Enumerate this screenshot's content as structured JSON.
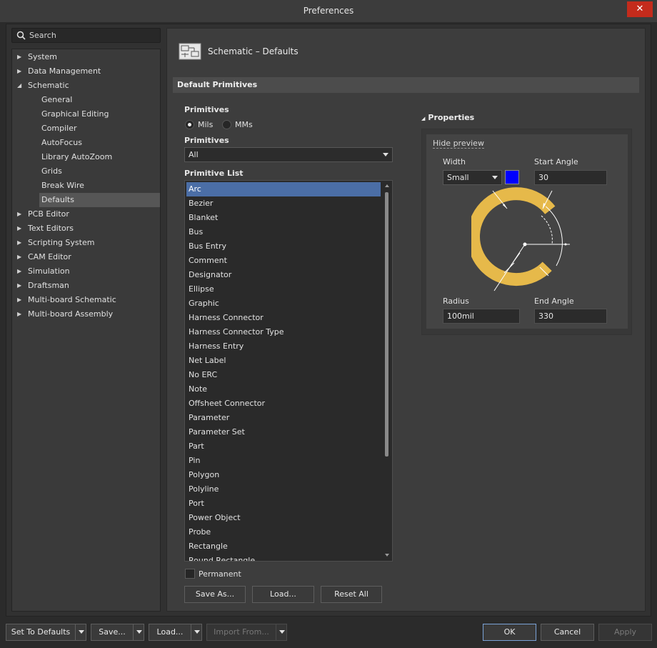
{
  "window": {
    "title": "Preferences",
    "close_symbol": "✕"
  },
  "search": {
    "placeholder": "Search"
  },
  "tree": {
    "items": [
      {
        "label": "System",
        "arrow": "▶",
        "level": 0
      },
      {
        "label": "Data Management",
        "arrow": "▶",
        "level": 0
      },
      {
        "label": "Schematic",
        "arrow": "◢",
        "level": 0
      },
      {
        "label": "General",
        "level": 1
      },
      {
        "label": "Graphical Editing",
        "level": 1
      },
      {
        "label": "Compiler",
        "level": 1
      },
      {
        "label": "AutoFocus",
        "level": 1
      },
      {
        "label": "Library AutoZoom",
        "level": 1
      },
      {
        "label": "Grids",
        "level": 1
      },
      {
        "label": "Break Wire",
        "level": 1
      },
      {
        "label": "Defaults",
        "level": 1,
        "selected": true
      },
      {
        "label": "PCB Editor",
        "arrow": "▶",
        "level": 0
      },
      {
        "label": "Text Editors",
        "arrow": "▶",
        "level": 0
      },
      {
        "label": "Scripting System",
        "arrow": "▶",
        "level": 0
      },
      {
        "label": "CAM Editor",
        "arrow": "▶",
        "level": 0
      },
      {
        "label": "Simulation",
        "arrow": "▶",
        "level": 0
      },
      {
        "label": "Draftsman",
        "arrow": "▶",
        "level": 0
      },
      {
        "label": "Multi-board Schematic",
        "arrow": "▶",
        "level": 0
      },
      {
        "label": "Multi-board Assembly",
        "arrow": "▶",
        "level": 0
      }
    ]
  },
  "page": {
    "title": "Schematic – Defaults",
    "section": "Default Primitives",
    "units_label": "Primitives",
    "unit_options": [
      {
        "label": "Mils",
        "checked": true
      },
      {
        "label": "MMs",
        "checked": false
      }
    ],
    "filter_label": "Primitives",
    "filter_value": "All",
    "list_label": "Primitive List",
    "list_items": [
      "Arc",
      "Bezier",
      "Blanket",
      "Bus",
      "Bus Entry",
      "Comment",
      "Designator",
      "Ellipse",
      "Graphic",
      "Harness Connector",
      "Harness Connector Type",
      "Harness Entry",
      "Net Label",
      "No ERC",
      "Note",
      "Offsheet Connector",
      "Parameter",
      "Parameter Set",
      "Part",
      "Pin",
      "Polygon",
      "Polyline",
      "Port",
      "Power Object",
      "Probe",
      "Rectangle",
      "Round Rectangle"
    ],
    "selected_item": "Arc",
    "permanent_label": "Permanent",
    "permanent_checked": false,
    "buttons": {
      "save_as": "Save As...",
      "load": "Load...",
      "reset_all": "Reset All"
    }
  },
  "properties": {
    "title": "Properties",
    "collapse_symbol": "◢",
    "hide_preview": "Hide preview",
    "width_label": "Width",
    "width_value": "Small",
    "color": "#0000ff",
    "start_angle_label": "Start Angle",
    "start_angle_value": "30",
    "radius_label": "Radius",
    "radius_value": "100mil",
    "end_angle_label": "End Angle",
    "end_angle_value": "330",
    "arc_color": "#e6b94a"
  },
  "footer": {
    "set_to_defaults": "Set To Defaults",
    "save": "Save...",
    "load": "Load...",
    "import_from": "Import From...",
    "ok": "OK",
    "cancel": "Cancel",
    "apply": "Apply"
  }
}
